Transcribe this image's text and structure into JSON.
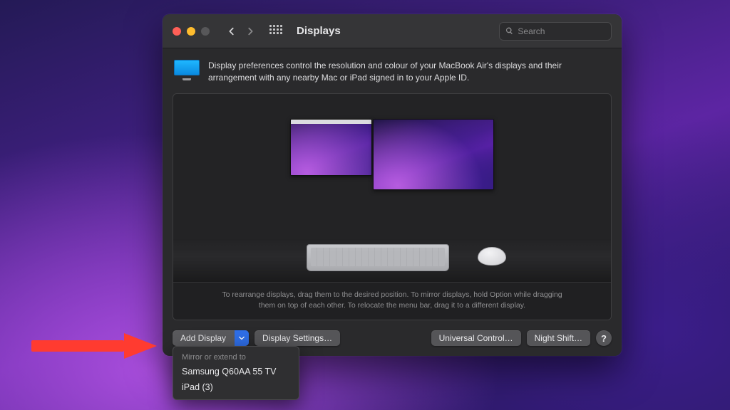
{
  "colors": {
    "traffic_close": "#ff5f57",
    "traffic_min": "#febc2e",
    "traffic_max": "#575759"
  },
  "titlebar": {
    "title": "Displays",
    "search_placeholder": "Search"
  },
  "description": "Display preferences control the resolution and colour of your MacBook Air's displays and their arrangement with any nearby Mac or iPad signed in to your Apple ID.",
  "hint": {
    "line1": "To rearrange displays, drag them to the desired position. To mirror displays, hold Option while dragging",
    "line2": "them on top of each other. To relocate the menu bar, drag it to a different display."
  },
  "buttons": {
    "add_display": "Add Display",
    "display_settings": "Display Settings…",
    "universal_control": "Universal Control…",
    "night_shift": "Night Shift…",
    "help": "?"
  },
  "dropdown": {
    "header": "Mirror or extend to",
    "items": [
      "Samsung Q60AA 55 TV",
      "iPad (3)"
    ]
  }
}
